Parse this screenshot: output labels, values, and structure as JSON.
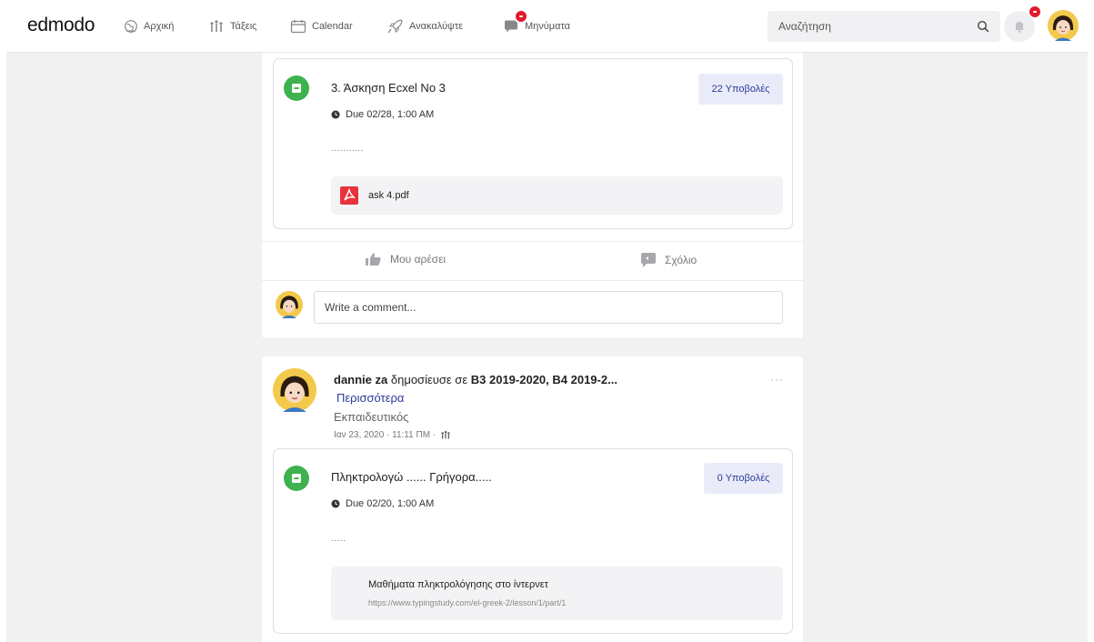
{
  "nav": {
    "logo": "edmodo",
    "items": [
      {
        "label": "Αρχική",
        "icon": "home-globe-icon"
      },
      {
        "label": "Τάξεις",
        "icon": "classes-icon"
      },
      {
        "label": "Calendar",
        "icon": "calendar-icon"
      },
      {
        "label": "Ανακαλύψτε",
        "icon": "rocket-icon"
      },
      {
        "label": "Μηνύματα",
        "icon": "messages-icon"
      }
    ],
    "search_placeholder": "Αναζήτηση",
    "accent_badge_color": "#e2192c"
  },
  "post1": {
    "assignment": {
      "title": "3. Άσκηση Ecxel No 3",
      "submissions": "22 Υποβολές",
      "due": "Due 02/28, 1:00 AM",
      "description": "...........",
      "attachment": "ask 4.pdf"
    },
    "like_label": "Μου αρέσει",
    "comment_label": "Σχόλιο",
    "comment_placeholder": "Write a comment..."
  },
  "post2": {
    "author": "dannie za",
    "posted_in": "δημοσίευσε σε",
    "classes": "Β3 2019-2020,  Β4 2019-2...",
    "more_link": "Περισσότερα",
    "role": "Εκπαιδευτικός",
    "timestamp": "Ιαν 23, 2020 · 11:11 ΠΜ ·",
    "menu": "···",
    "assignment": {
      "title": "Πληκτρολογώ ...... Γρήγορα.....",
      "submissions": "0 Υποβολές",
      "due": "Due 02/20, 1:00 AM",
      "description": ".....",
      "link_title": "Μαθήματα πληκτρολόγησης στο ίντερνετ",
      "link_url": "https://www.typingstudy.com/el-greek-2/lesson/1/part/1"
    }
  },
  "colors": {
    "assignment_green": "#3eb24e",
    "submissions_text": "#2c3a9a",
    "more_link": "#2c3a9a",
    "pdf_red": "#e8323c"
  }
}
